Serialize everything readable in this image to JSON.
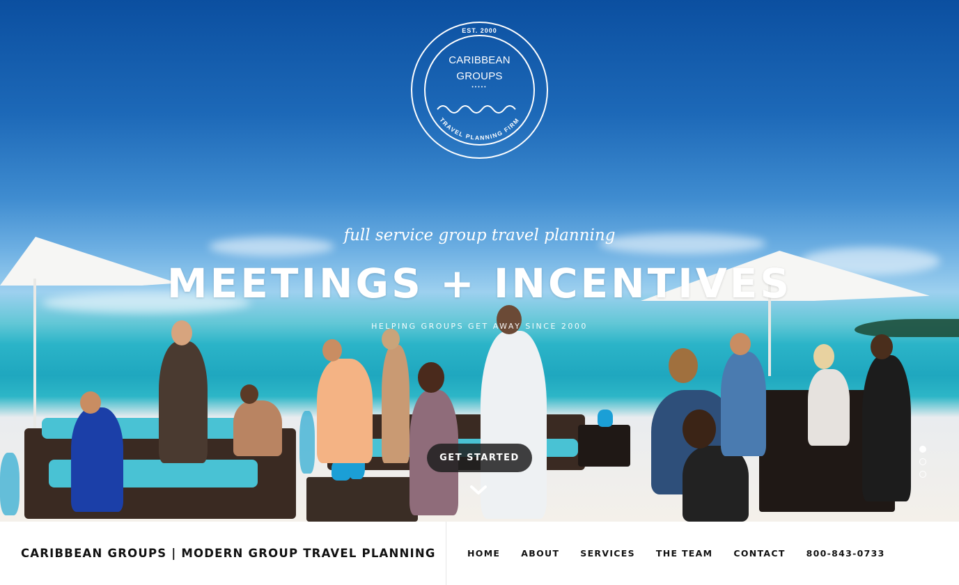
{
  "logo": {
    "est": "EST. 2000",
    "name_line1": "CARIBBEAN",
    "name_line2": "GROUPS",
    "dots": "•••••",
    "ring_text": "TRAVEL  PLANNING  FIRM"
  },
  "hero": {
    "tagline": "full service group travel planning",
    "headline": "MEETINGS + INCENTIVES",
    "subline": "HELPING GROUPS GET AWAY SINCE 2000",
    "cta_label": "GET STARTED",
    "slides_total": 3,
    "slide_active": 1
  },
  "navbar": {
    "brand": "CARIBBEAN GROUPS | MODERN GROUP TRAVEL PLANNING",
    "links": [
      "HOME",
      "ABOUT",
      "SERVICES",
      "THE TEAM",
      "CONTACT",
      "800-843-0733"
    ]
  },
  "colors": {
    "sky": "#1d69b8",
    "sea": "#2bb4c8",
    "cta_bg": "#1e1e1e",
    "text_dark": "#111111"
  }
}
